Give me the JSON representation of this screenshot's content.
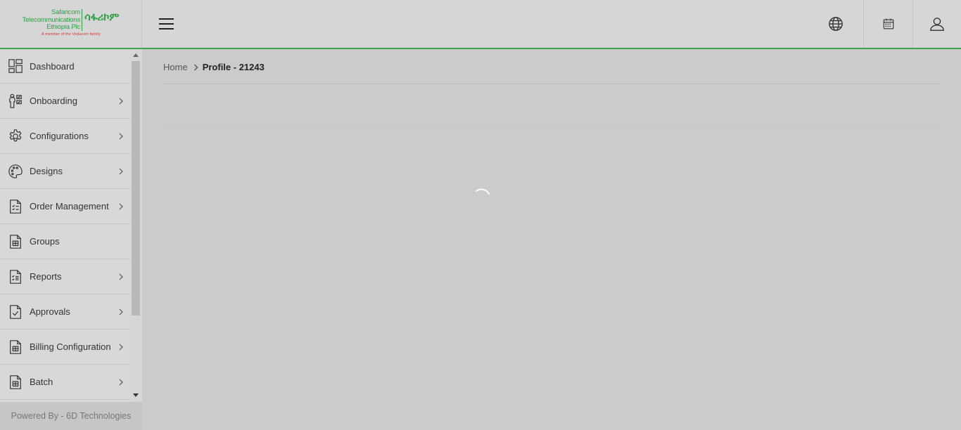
{
  "header": {
    "logo": {
      "line1": "Safaricom",
      "line2": "Telecommunications",
      "line3": "Ethiopia Plc",
      "amharic": "ሳፋሪኮም",
      "tagline": "A member of the Vodacom family"
    },
    "icons": [
      "menu-icon",
      "globe-icon",
      "calendar-icon",
      "user-icon"
    ]
  },
  "sidebar": {
    "items": [
      {
        "label": "Dashboard",
        "icon": "dashboard-icon",
        "has_submenu": false
      },
      {
        "label": "Onboarding",
        "icon": "onboarding-icon",
        "has_submenu": true
      },
      {
        "label": "Configurations",
        "icon": "gear-icon",
        "has_submenu": true
      },
      {
        "label": "Designs",
        "icon": "palette-icon",
        "has_submenu": true
      },
      {
        "label": "Order Management",
        "icon": "order-document-icon",
        "has_submenu": true
      },
      {
        "label": "Groups",
        "icon": "document-icon",
        "has_submenu": false
      },
      {
        "label": "Reports",
        "icon": "report-document-icon",
        "has_submenu": true
      },
      {
        "label": "Approvals",
        "icon": "check-document-icon",
        "has_submenu": true
      },
      {
        "label": "Billing Configuration",
        "icon": "document-icon",
        "has_submenu": true
      },
      {
        "label": "Batch",
        "icon": "document-icon",
        "has_submenu": true
      }
    ],
    "footer": "Powered By - 6D Technologies"
  },
  "main": {
    "breadcrumb": {
      "home": "Home",
      "current": "Profile - 21243"
    }
  },
  "colors": {
    "brand_green": "#2f9e44",
    "header_border": "#3aa84a",
    "background": "#cbcbcd"
  }
}
